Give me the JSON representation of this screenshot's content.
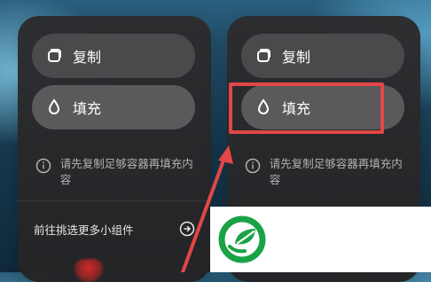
{
  "left_panel": {
    "copy_label": "复制",
    "fill_label": "填充",
    "info_text": "请先复制足够容器再填充内容",
    "more_label": "前往挑选更多小组件"
  },
  "right_panel": {
    "copy_label": "复制",
    "fill_label": "填充",
    "info_text": "请先复制足够容器再填充内容"
  },
  "icons": {
    "copy": "copy-icon",
    "fill": "droplet-icon",
    "info": "info-icon",
    "arrow": "arrow-right-circle-icon",
    "logo": "leaf-logo"
  },
  "colors": {
    "highlight": "#e24646",
    "logo": "#19a346"
  }
}
